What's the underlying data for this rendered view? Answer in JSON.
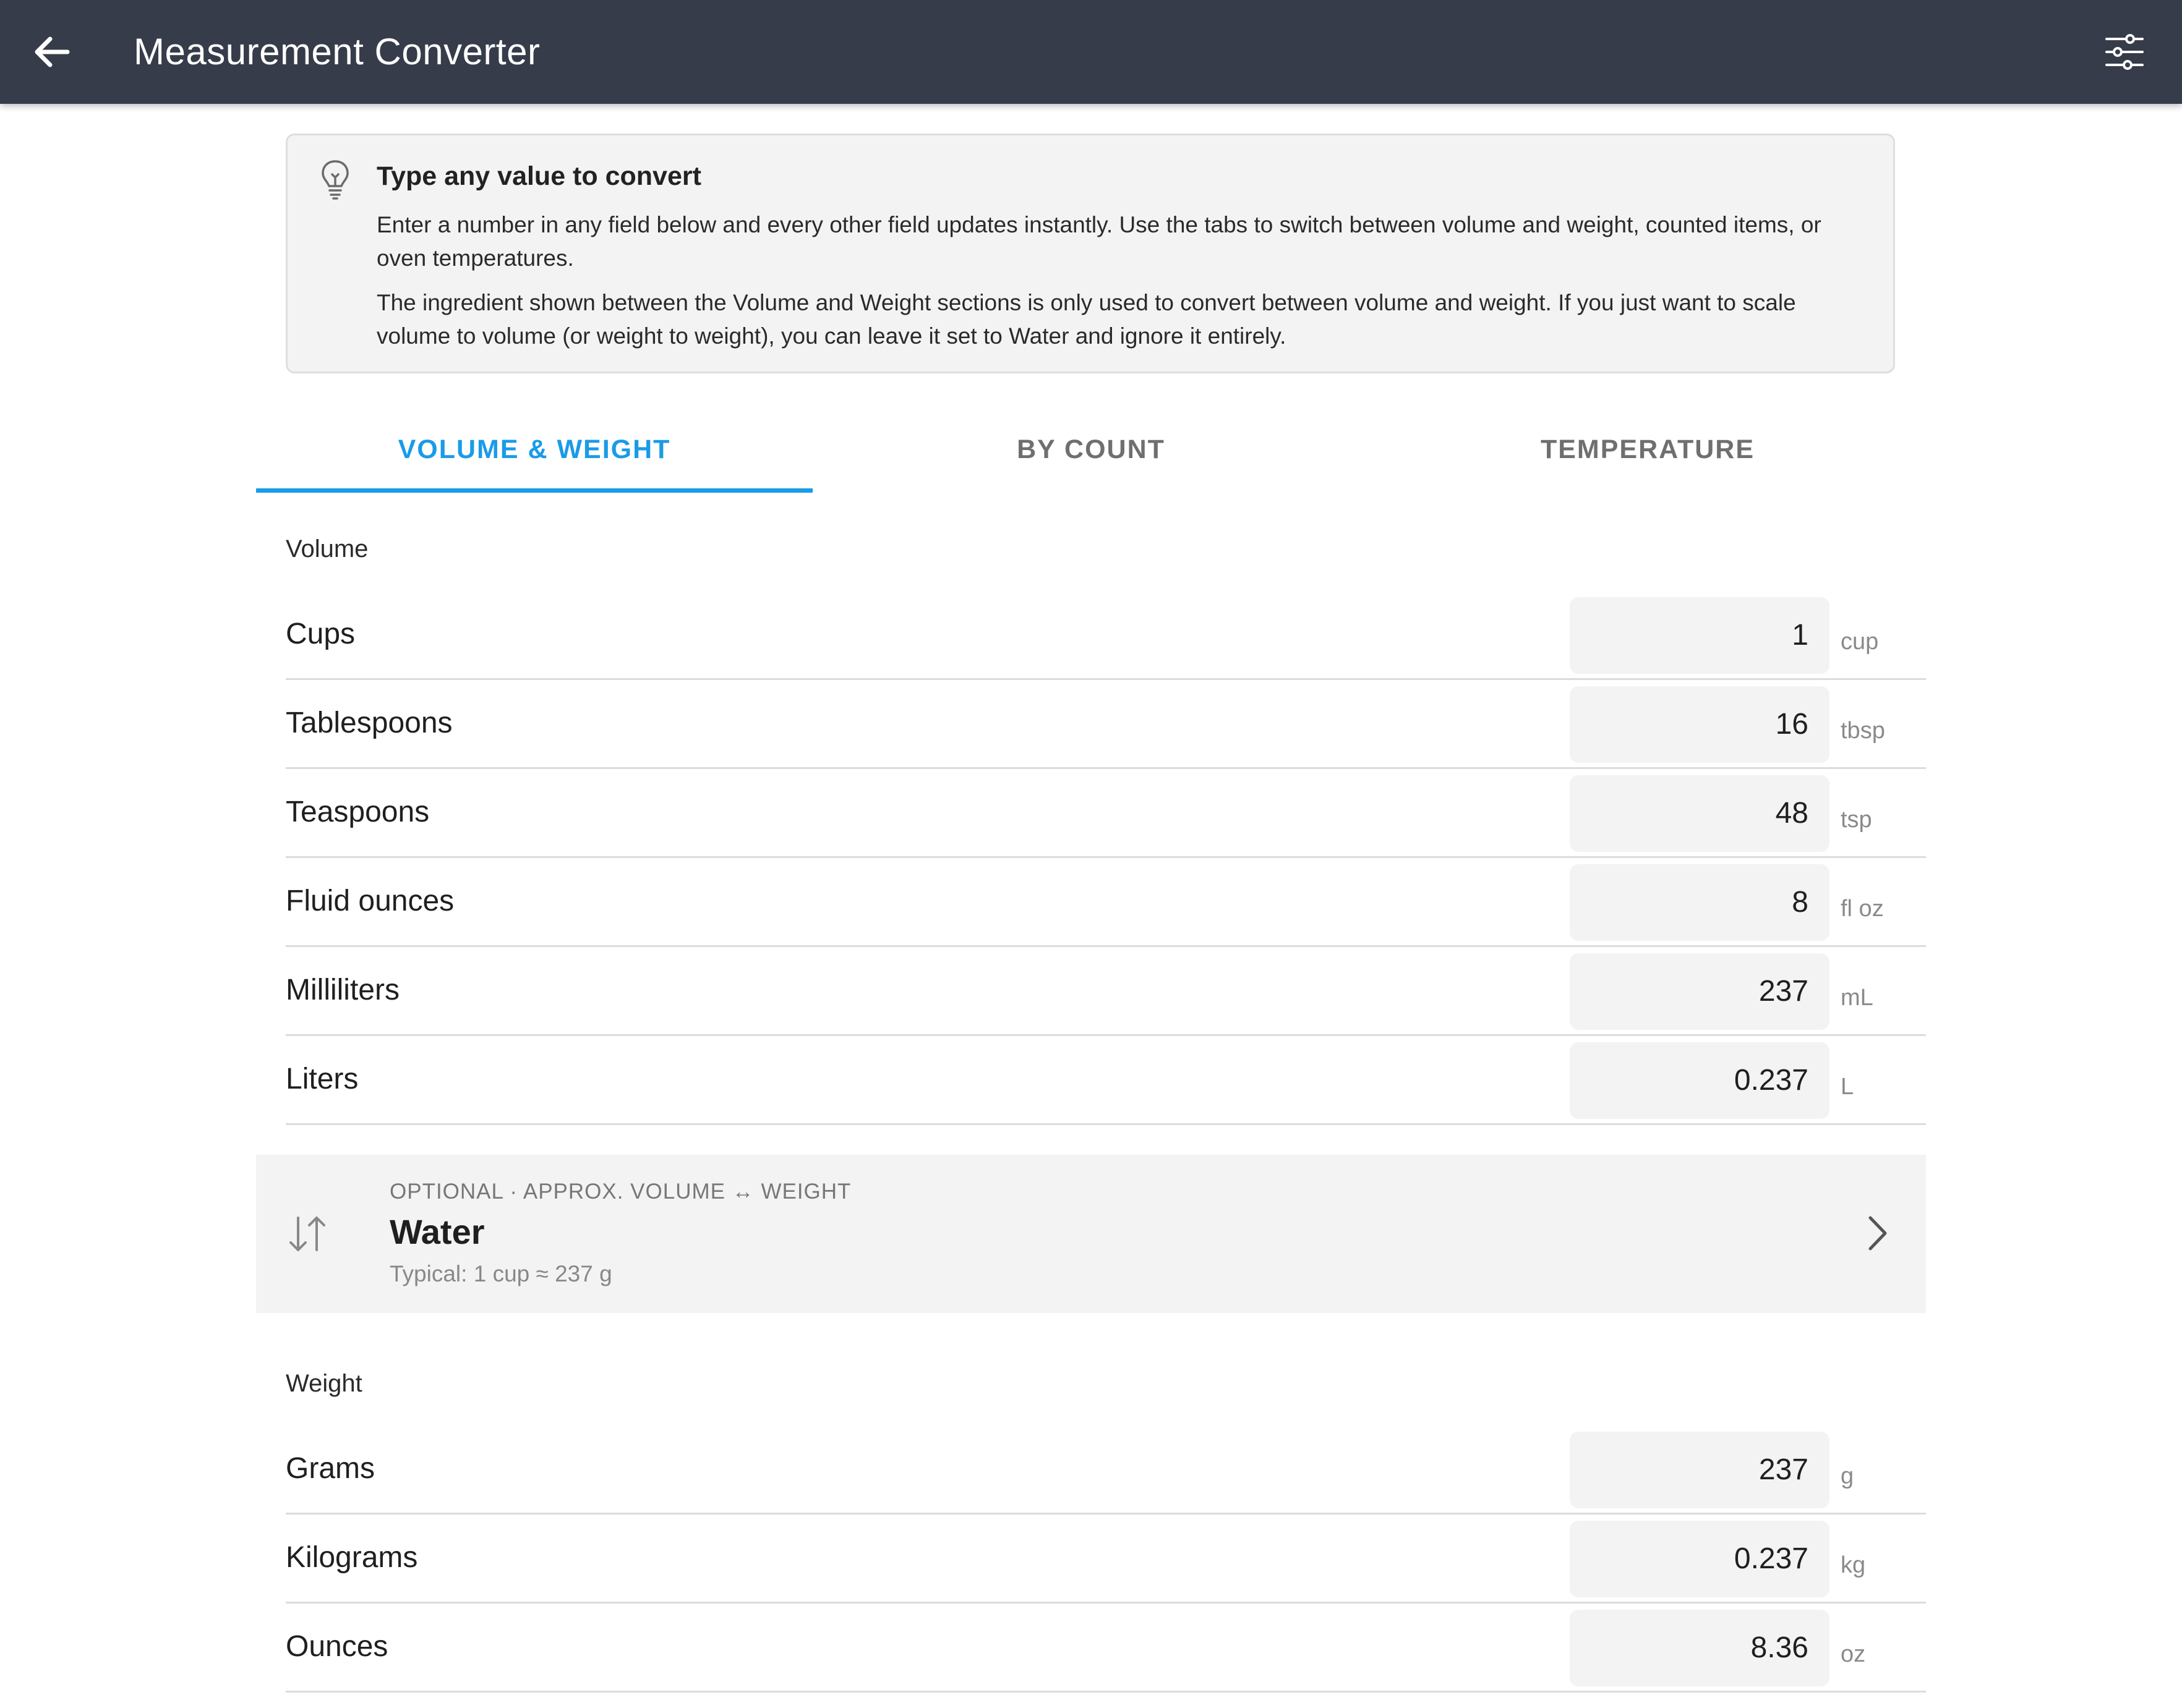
{
  "appbar": {
    "title": "Measurement Converter",
    "back_icon": "arrow-left-icon",
    "settings_icon": "sliders-icon"
  },
  "info": {
    "icon": "lightbulb-icon",
    "title": "Type any value to convert",
    "paragraph1": "Enter a number in any field below and every other field updates instantly. Use the tabs to switch between volume and weight, counted items, or oven temperatures.",
    "paragraph2": "The ingredient shown between the Volume and Weight sections is only used to convert between volume and weight. If you just want to scale volume to volume (or weight to weight), you can leave it set to Water and ignore it entirely."
  },
  "tabs": [
    {
      "label": "VOLUME & WEIGHT",
      "active": true
    },
    {
      "label": "BY COUNT",
      "active": false
    },
    {
      "label": "TEMPERATURE",
      "active": false
    }
  ],
  "colors": {
    "appbar": "#363c4a",
    "accent": "#1a9be8",
    "field_bg": "#f3f3f3"
  },
  "volume": {
    "label": "Volume",
    "rows": [
      {
        "label": "Cups",
        "value": "1",
        "unit": "cup"
      },
      {
        "label": "Tablespoons",
        "value": "16",
        "unit": "tbsp"
      },
      {
        "label": "Teaspoons",
        "value": "48",
        "unit": "tsp"
      },
      {
        "label": "Fluid ounces",
        "value": "8",
        "unit": "fl oz"
      },
      {
        "label": "Milliliters",
        "value": "237",
        "unit": "mL"
      },
      {
        "label": "Liters",
        "value": "0.237",
        "unit": "L"
      }
    ]
  },
  "ingredient": {
    "icon": "swap-vertical-icon",
    "caption": "OPTIONAL · APPROX. VOLUME ↔ WEIGHT",
    "name": "Water",
    "typical": "Typical: 1 cup ≈ 237 g",
    "chevron_icon": "chevron-right-icon"
  },
  "weight": {
    "label": "Weight",
    "rows": [
      {
        "label": "Grams",
        "value": "237",
        "unit": "g"
      },
      {
        "label": "Kilograms",
        "value": "0.237",
        "unit": "kg"
      },
      {
        "label": "Ounces",
        "value": "8.36",
        "unit": "oz"
      }
    ]
  }
}
